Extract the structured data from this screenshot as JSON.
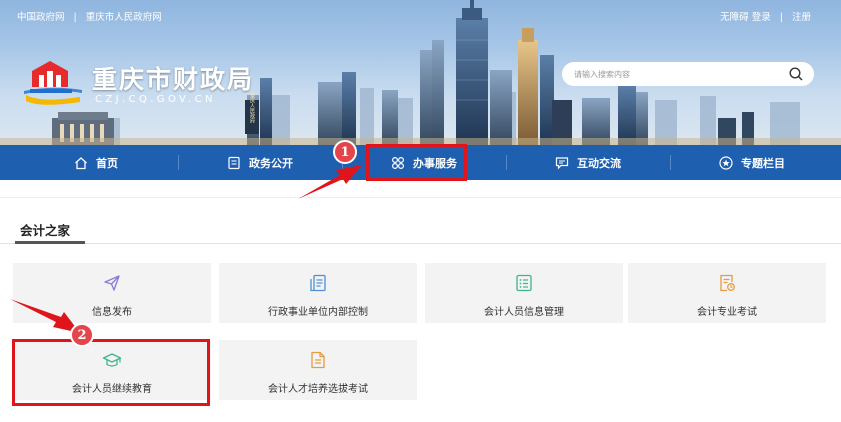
{
  "header": {
    "links": [
      "中国政府网",
      "重庆市人民政府网"
    ],
    "link_separator": "|",
    "account": {
      "accessible": "无障碍",
      "login": "登录",
      "sep": "|",
      "register": "注册"
    },
    "site_title": "重庆市财政局",
    "site_domain": "CZJ.CQ.GOV.CN",
    "search_placeholder": "请输入搜索内容",
    "banner_sign": "重庆人民政府"
  },
  "nav": {
    "items": [
      {
        "label": "首页",
        "icon": "home-icon"
      },
      {
        "label": "政务公开",
        "icon": "document-icon"
      },
      {
        "label": "办事服务",
        "icon": "service-icon"
      },
      {
        "label": "互动交流",
        "icon": "chat-icon"
      },
      {
        "label": "专题栏目",
        "icon": "star-icon"
      }
    ]
  },
  "section": {
    "title": "会计之家",
    "cards": [
      {
        "label": "信息发布",
        "icon": "paper-plane-icon",
        "icon_color": "#8a7fd6"
      },
      {
        "label": "行政事业单位内部控制",
        "icon": "report-icon",
        "icon_color": "#4b8fd9"
      },
      {
        "label": "会计人员信息管理",
        "icon": "list-icon",
        "icon_color": "#3fb58e"
      },
      {
        "label": "会计专业考试",
        "icon": "exam-icon",
        "icon_color": "#e89a3c"
      },
      {
        "label": "会计人员继续教育",
        "icon": "graduation-cap-icon",
        "icon_color": "#3fb58e"
      },
      {
        "label": "会计人才培养选拔考试",
        "icon": "file-icon",
        "icon_color": "#e89a3c"
      }
    ]
  },
  "annotations": {
    "step1": "1",
    "step2": "2",
    "highlight_color": "#e0151b",
    "badge_color": "#e4454b"
  },
  "colors": {
    "nav_bg": "#1f5fb0",
    "card_bg": "#f3f3f3"
  }
}
